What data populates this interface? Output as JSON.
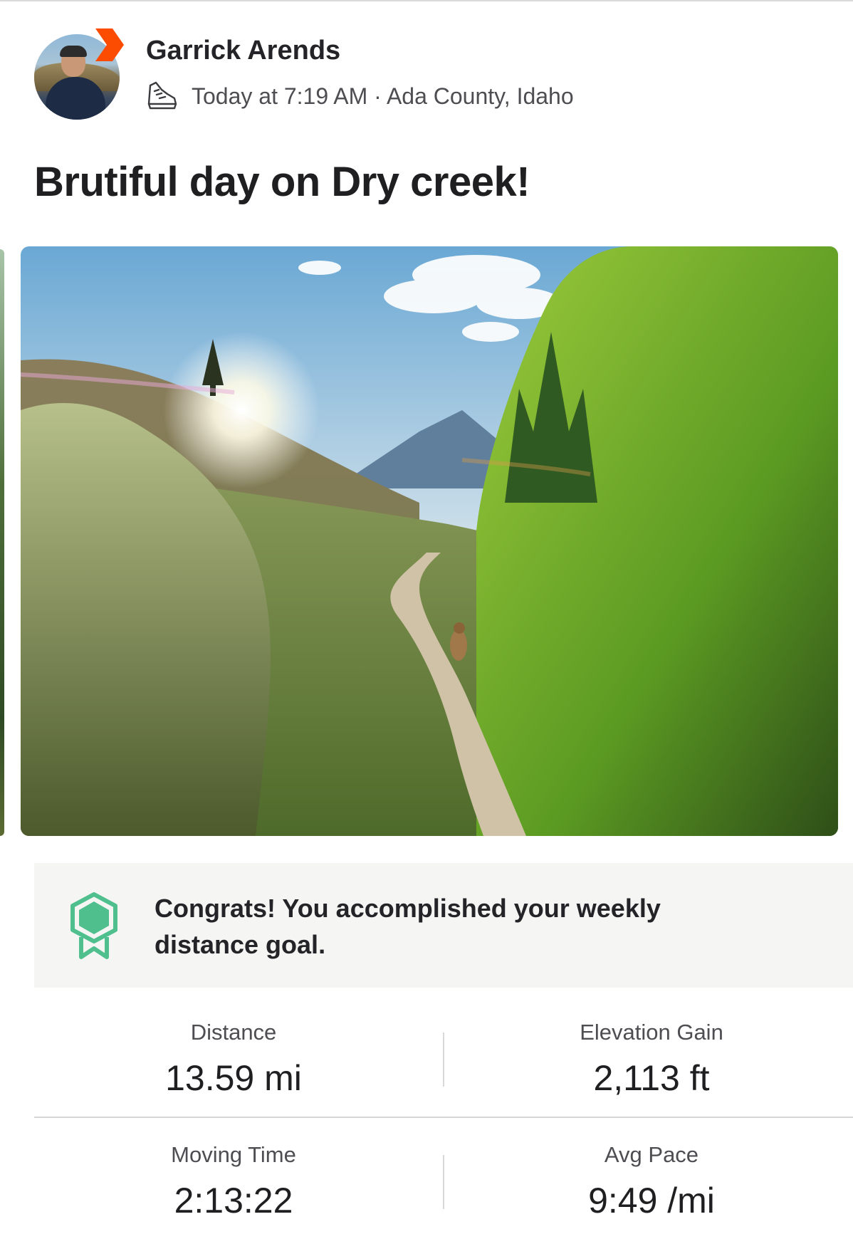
{
  "athlete": {
    "name": "Garrick Arends",
    "avatar_icon": "athlete-avatar",
    "badge_icon": "strava-chevron-icon",
    "badge_color": "#fc4c02"
  },
  "activity": {
    "type_icon": "shoe-run-icon",
    "meta": "Today at 7:19 AM · Ada County, Idaho",
    "title": "Brutiful day on Dry creek!"
  },
  "goal": {
    "icon": "achievement-badge-icon",
    "icon_color": "#4fbf8e",
    "message": "Congrats! You accomplished your weekly distance goal."
  },
  "stats": [
    {
      "label": "Distance",
      "value": "13.59 mi"
    },
    {
      "label": "Elevation Gain",
      "value": "2,113 ft"
    },
    {
      "label": "Moving Time",
      "value": "2:13:22"
    },
    {
      "label": "Avg Pace",
      "value": "9:49 /mi"
    }
  ]
}
